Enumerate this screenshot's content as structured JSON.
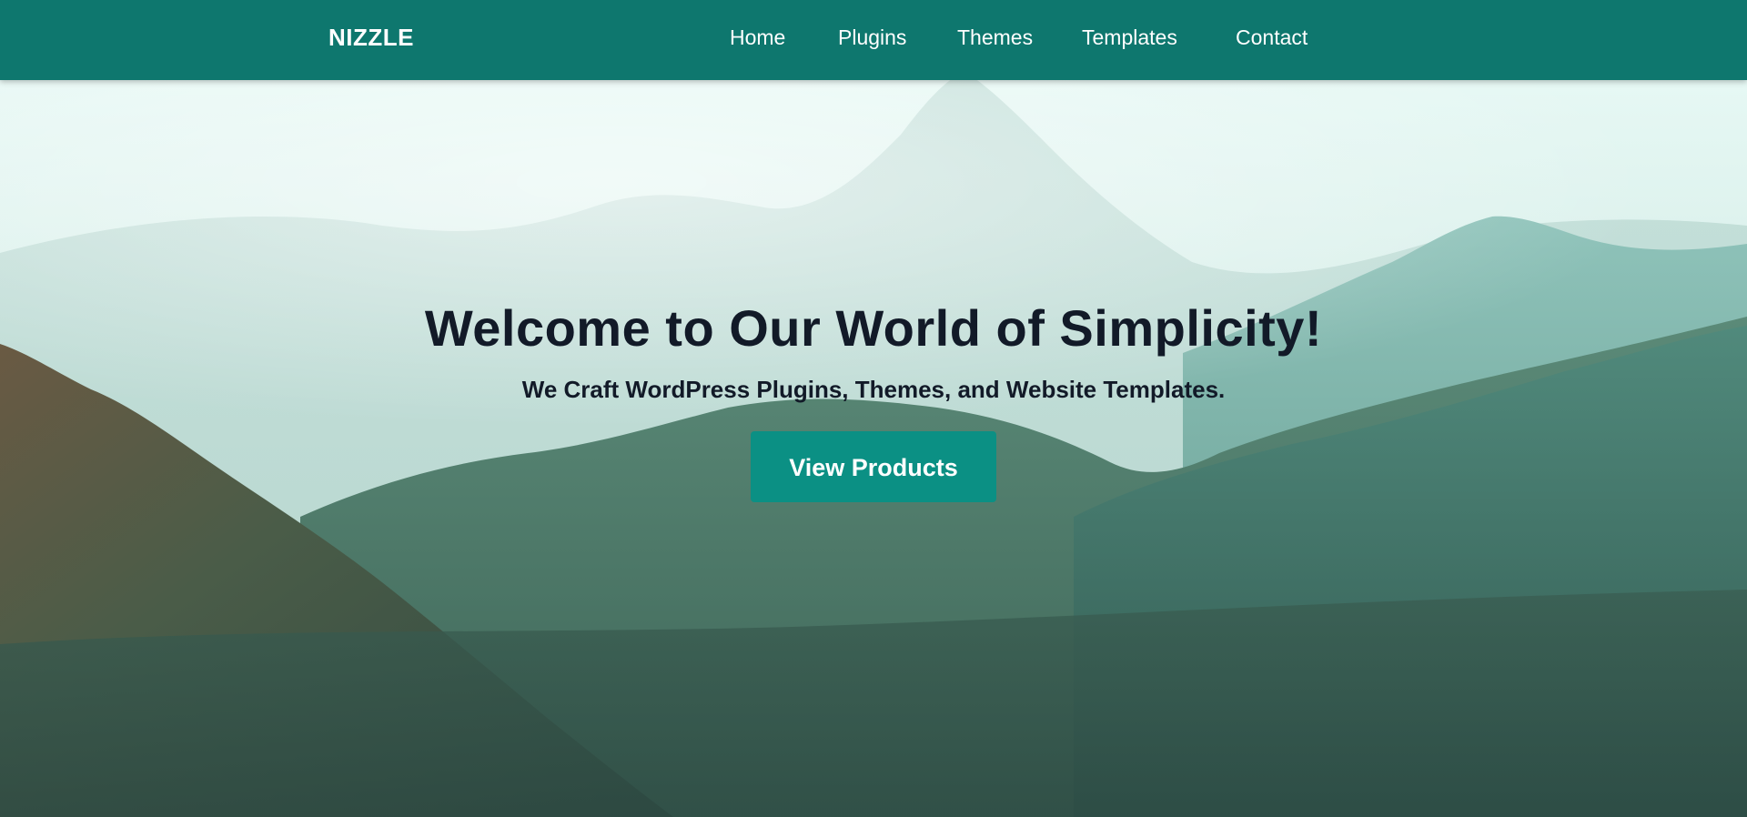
{
  "header": {
    "logo": "NIZZLE",
    "nav": [
      {
        "label": "Home"
      },
      {
        "label": "Plugins"
      },
      {
        "label": "Themes"
      },
      {
        "label": "Templates"
      },
      {
        "label": "Contact"
      }
    ]
  },
  "hero": {
    "title": "Welcome to Our World of Simplicity!",
    "subtitle": "We Craft WordPress Plugins, Themes, and Website Templates.",
    "cta_label": "View Products"
  },
  "colors": {
    "brand": "#0e776e",
    "button": "#0b9084",
    "heading_text": "#121a28"
  }
}
